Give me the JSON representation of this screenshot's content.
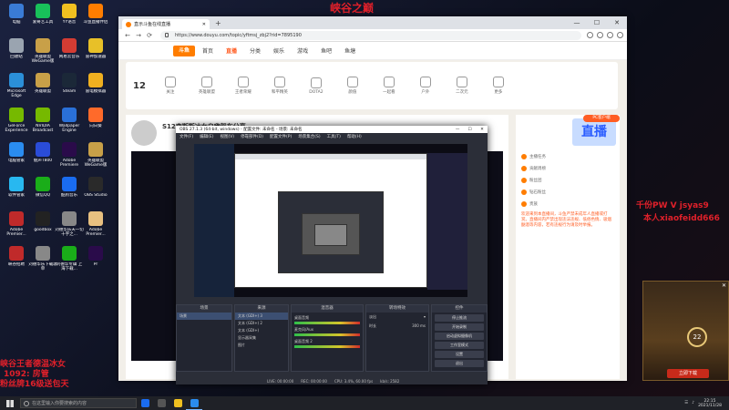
{
  "overlays": {
    "top_title": "峡谷之巅",
    "right_line1": "千份PW V jsyas9",
    "right_line2": "本人xiaofeidd666",
    "left_line1": "峡谷王者德温冰女",
    "left_line2": "1092: 房管",
    "left_line3": "粉丝牌16级送包天"
  },
  "desktop_icons": [
    {
      "label": "电脑",
      "color": "#3a7bd5"
    },
    {
      "label": "爱奇艺工具",
      "color": "#18c05a"
    },
    {
      "label": "YY语音",
      "color": "#f0c020"
    },
    {
      "label": "斗鱼直播伴侣",
      "color": "#ff7d00"
    },
    {
      "label": "回收站",
      "color": "#9aa4b0"
    },
    {
      "label": "英雄联盟WeGame版",
      "color": "#c8a048"
    },
    {
      "label": "网易云音乐",
      "color": "#d43c33"
    },
    {
      "label": "雷神加速器",
      "color": "#e8c028"
    },
    {
      "label": "Microsoft Edge",
      "color": "#2b8fd8"
    },
    {
      "label": "英雄联盟",
      "color": "#c8a048"
    },
    {
      "label": "Steam",
      "color": "#1b2838"
    },
    {
      "label": "雷电模拟器",
      "color": "#f0b020"
    },
    {
      "label": "GeForce Experience",
      "color": "#76b900"
    },
    {
      "label": "NVIDIA Broadcast",
      "color": "#76b900"
    },
    {
      "label": "Wallpaper Engine",
      "color": "#2a70d8"
    },
    {
      "label": "向日葵",
      "color": "#ff6a2a"
    },
    {
      "label": "电脑管家",
      "color": "#2a8cf0"
    },
    {
      "label": "魅声T800",
      "color": "#2a4cd8"
    },
    {
      "label": "Adobe Premiere",
      "color": "#2a0b4a"
    },
    {
      "label": "英雄联盟WeGame版",
      "color": "#c8a048"
    },
    {
      "label": "软件管家",
      "color": "#28b8f0"
    },
    {
      "label": "微信QQ",
      "color": "#1aad19"
    },
    {
      "label": "酷狗音乐",
      "color": "#1a6cf0"
    },
    {
      "label": "OBS Studio",
      "color": "#2a2a2a"
    },
    {
      "label": "Adobe Premier...",
      "color": "#c02a2a"
    },
    {
      "label": "goodbox",
      "color": "#222"
    },
    {
      "label": "刘德华乐天一切十字之...",
      "color": "#888"
    },
    {
      "label": "Adobe Premier...",
      "color": "#e8c080"
    },
    {
      "label": "峡谷招聘",
      "color": "#c02a2a"
    },
    {
      "label": "刘德华乐下载歌单",
      "color": "#888"
    },
    {
      "label": "刘德华专辑 上海下载...",
      "color": "#1aad19"
    },
    {
      "label": "Pr",
      "color": "#2a0b4a"
    }
  ],
  "browser": {
    "tab_title": "直示斗鱼在线直播",
    "url": "https://www.douyu.com/topic/yftmsj_zbj2?rid=7895190",
    "win_controls": [
      "—",
      "☐",
      "✕"
    ],
    "nav_items": [
      "首页",
      "直播",
      "分类",
      "娱乐",
      "游戏",
      "鱼吧",
      "鱼塘"
    ],
    "category_number": "12",
    "categories": [
      "关注",
      "英雄联盟",
      "王者荣耀",
      "和平精英",
      "DOTA2",
      "颜值",
      "一起看",
      "户外",
      "二次元",
      "更多"
    ],
    "room_title": "S12李斯斯冰女自嗨驾车分享",
    "side_badge": "PC客户端",
    "side_rows": [
      "主播任务",
      "贡献周榜",
      "粉丝团",
      "钻石粉丝",
      "贵族"
    ],
    "side_text": "欢迎来到本直播间，斗鱼严禁未成年人直播或打赏。直播间内严禁出现违法违规、低俗色情、吸烟酗酒等内容，若有违规行为请及时举报。",
    "side_rec": "直播"
  },
  "obs": {
    "title": "OBS 27.1.3 (64-bit, windows) - 配置文件: 未命名 - 场景: 未命名",
    "title_controls": [
      "—",
      "☐",
      "✕"
    ],
    "menu": [
      "文件(F)",
      "编辑(E)",
      "视图(V)",
      "停靠部件(D)",
      "配置文件(P)",
      "场景集合(S)",
      "工具(T)",
      "帮助(H)"
    ],
    "panels": {
      "scenes": "场景",
      "sources": "来源",
      "mixer": "混音器",
      "transitions": "转场特效",
      "controls": "控件"
    },
    "scene_list": [
      "场景"
    ],
    "sources": [
      "文本 (GDI+) 3",
      "文本 (GDI+) 2",
      "文本 (GDI+)",
      "显示器采集",
      "图片"
    ],
    "mixer_rows": [
      "桌面音频",
      "麦克风/Aux",
      "桌面音频 2"
    ],
    "transition_name": "淡出",
    "transition_duration_label": "时长",
    "transition_duration": "300 ms",
    "controls": [
      "停止推流",
      "开始录制",
      "启动虚拟摄像机",
      "工作室模式",
      "设置",
      "退出"
    ],
    "status": [
      "LIVE: 00:00:00",
      "REC: 00:00:00",
      "CPU: 3.4%, 60.00 fps",
      "kb/s: 2582"
    ]
  },
  "ad": {
    "level": "22",
    "button": "立即下载",
    "close": "✕"
  },
  "taskbar": {
    "search_placeholder": "在这里输入你要搜索的内容",
    "apps": [
      "#1a6cf0",
      "#555",
      "#f0c020",
      "#2a8cf0"
    ],
    "time": "22:15",
    "date": "2021/11/28"
  }
}
